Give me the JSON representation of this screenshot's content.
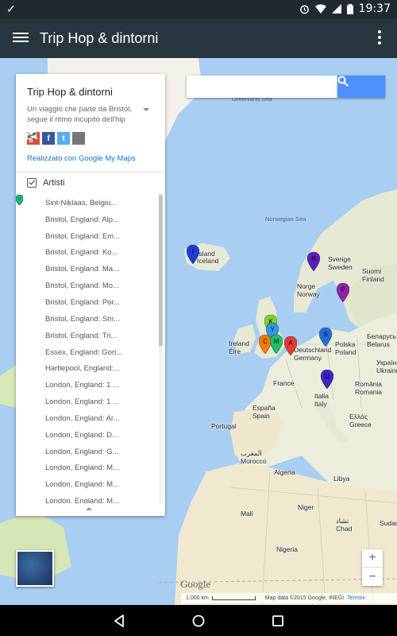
{
  "status_bar": {
    "time": "19:37"
  },
  "app_bar": {
    "title": "Trip Hop & dintorni"
  },
  "search": {
    "placeholder": ""
  },
  "panel": {
    "title": "Trip Hop & dintorni",
    "description": "Un viaggio che parte da Bristol, segue il ritmo incupito dell'hip",
    "made_with": "Realizzato con Google My Maps",
    "layer_name": "Artisti",
    "items": [
      {
        "label": "Sint-Niklaas, Belgiu...",
        "color": "#e53935",
        "letter": ""
      },
      {
        "label": "Bristol, England: Alp...",
        "color": "#e53935",
        "letter": ""
      },
      {
        "label": "Bristol, England: Em...",
        "color": "#f4511e",
        "letter": ""
      },
      {
        "label": "Bristol, England: Ko...",
        "color": "#f57c00",
        "letter": ""
      },
      {
        "label": "Bristol, England: Ma...",
        "color": "#fb8c00",
        "letter": ""
      },
      {
        "label": "Bristol, England: Mo...",
        "color": "#ffa000",
        "letter": ""
      },
      {
        "label": "Bristol, England: Por...",
        "color": "#fbc02d",
        "letter": ""
      },
      {
        "label": "Bristol, England: Sm...",
        "color": "#fdd835",
        "letter": ""
      },
      {
        "label": "Bristol, England: Tri...",
        "color": "#e6ee3c",
        "letter": ""
      },
      {
        "label": "Essex, England: Gori...",
        "color": "#c6e02a",
        "letter": ""
      },
      {
        "label": "Hartlepool, England:...",
        "color": "#8bd42e",
        "letter": ""
      },
      {
        "label": "London, England: 1 ...",
        "color": "#66d33a",
        "letter": ""
      },
      {
        "label": "London, England: 1 ...",
        "color": "#43c74a",
        "letter": ""
      },
      {
        "label": "London, England: Ar...",
        "color": "#2ec651",
        "letter": ""
      },
      {
        "label": "London, England: D...",
        "color": "#1cc45a",
        "letter": ""
      },
      {
        "label": "London, England: G...",
        "color": "#18c268",
        "letter": ""
      },
      {
        "label": "London, England: M...",
        "color": "#17c272",
        "letter": ""
      },
      {
        "label": "London, England: M...",
        "color": "#15c27e",
        "letter": ""
      },
      {
        "label": "London, England: M...",
        "color": "#15c28c",
        "letter": ""
      }
    ]
  },
  "map": {
    "labels": [
      {
        "text": "Greenland Sea",
        "kind": "sea"
      },
      {
        "text": "Norwegian Sea",
        "kind": "sea"
      },
      {
        "text": "Island\nIceland",
        "kind": "land"
      },
      {
        "text": "Sverige\nSweden",
        "kind": "land"
      },
      {
        "text": "Suomi\nFinland",
        "kind": "land"
      },
      {
        "text": "Norge\nNorway",
        "kind": "land"
      },
      {
        "text": "Ireland\nÉire",
        "kind": "land"
      },
      {
        "text": "Deutschland\nGermany",
        "kind": "land"
      },
      {
        "text": "Polska\nPoland",
        "kind": "land"
      },
      {
        "text": "Україна\nUkraine",
        "kind": "land"
      },
      {
        "text": "France",
        "kind": "land"
      },
      {
        "text": "Italia\nItaly",
        "kind": "land"
      },
      {
        "text": "România\nRomania",
        "kind": "land"
      },
      {
        "text": "España\nSpain",
        "kind": "land"
      },
      {
        "text": "Ελλάς\nGreece",
        "kind": "land"
      },
      {
        "text": "Portugal",
        "kind": "land"
      },
      {
        "text": "المغرب\nMorocco",
        "kind": "land"
      },
      {
        "text": "Algeria",
        "kind": "land"
      },
      {
        "text": "Libya",
        "kind": "land"
      },
      {
        "text": "Mali",
        "kind": "land"
      },
      {
        "text": "Niger",
        "kind": "land"
      },
      {
        "text": "تشاد\nChad",
        "kind": "land"
      },
      {
        "text": "Nigeria",
        "kind": "land"
      },
      {
        "text": "Sudan",
        "kind": "land"
      },
      {
        "text": "Беларусь\nBelarus",
        "kind": "land"
      }
    ],
    "markers": [
      {
        "letter": "I",
        "color": "#1e3cd8"
      },
      {
        "letter": "N",
        "color": "#5c1fbf"
      },
      {
        "letter": "P",
        "color": "#8e24aa"
      },
      {
        "letter": "K",
        "color": "#7ed321"
      },
      {
        "letter": "Y",
        "color": "#2e9be8"
      },
      {
        "letter": "C",
        "color": "#f57c00"
      },
      {
        "letter": "M",
        "color": "#1ec06a"
      },
      {
        "letter": "A",
        "color": "#e53935"
      },
      {
        "letter": "S",
        "color": "#1e6fd8"
      },
      {
        "letter": "U",
        "color": "#3a26c9"
      }
    ],
    "google_logo": "Google",
    "scale": "1.000 km",
    "attribution": "Map data ©2015 Google, INEGI",
    "terms": "Termini"
  }
}
